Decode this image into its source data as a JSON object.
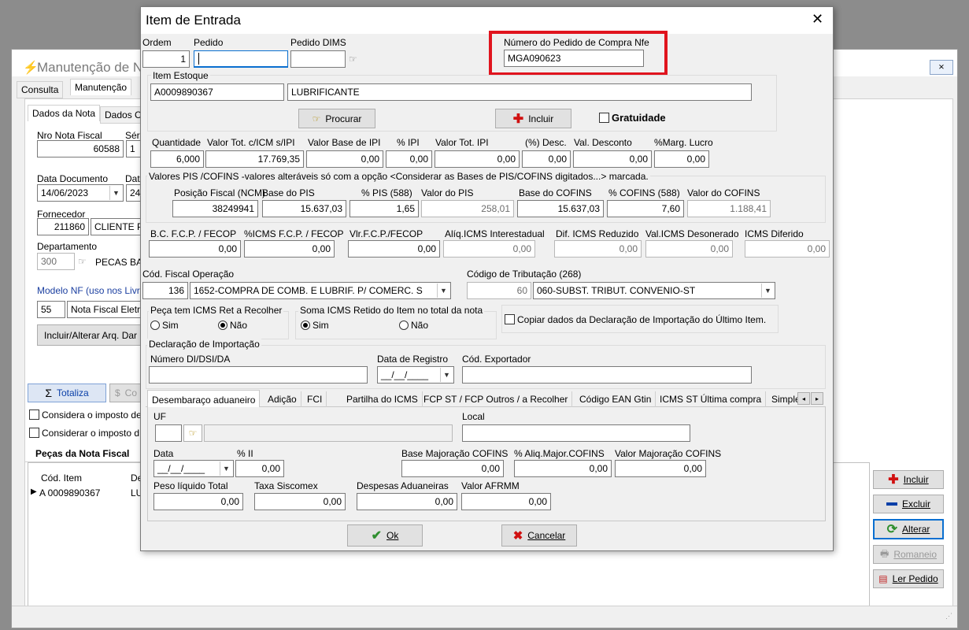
{
  "bg": {
    "title": "Manutenção de N",
    "tabs": [
      "Consulta",
      "Manutenção"
    ],
    "subtabs": [
      "Dados da Nota",
      "Dados C"
    ],
    "nro_nota_label": "Nro Nota Fiscal",
    "serie_label": "Séri",
    "nro_nota": "60588",
    "serie": "1",
    "data_doc_label": "Data Documento",
    "dat_label": "Dat",
    "data_doc": "14/06/2023",
    "dat2": "24,",
    "fornecedor_label": "Fornecedor",
    "fornecedor_cod": "211860",
    "fornecedor_nome": "CLIENTE P1",
    "departamento_label": "Departamento",
    "dep_cod": "300",
    "dep_nome": "PECAS BA",
    "modelo_label": "Modelo NF (uso nos Livro",
    "modelo_cod": "55",
    "modelo_nome": "Nota Fiscal Eletrô",
    "incluir_arq": "Incluir/Alterar Arq. Dar",
    "totaliza": "Totaliza",
    "co": "Co",
    "considera1": "Considera o imposto de",
    "considera2": "Considerar o imposto d",
    "pecas_title": "Peças da Nota Fiscal",
    "col_cod": "Cód. Item",
    "col_de": "De",
    "row_cod": "A  0009890367",
    "row_de": "LU",
    "incluir": "Incluir",
    "excluir": "Excluir",
    "alterar": "Alterar",
    "romaneio": "Romaneio",
    "ler_pedido": "Ler Pedido"
  },
  "dlg": {
    "title": "Item de Entrada",
    "ordem_label": "Ordem",
    "ordem": "1",
    "pedido_label": "Pedido",
    "pedido": "",
    "dims_label": "Pedido DIMS",
    "dims": "",
    "npc_label": "Número do Pedido de Compra Nfe",
    "npc": "MGA090623",
    "item_estoque_label": "Item Estoque",
    "item_cod": "A0009890367",
    "item_desc": "LUBRIFICANTE",
    "procurar": "Procurar",
    "incluir": "Incluir",
    "gratuidade": "Gratuidade",
    "quantidade_label": "Quantidade",
    "quantidade": "6,000",
    "vtot_label": "Valor Tot. c/ICM s/IPI",
    "vtot": "17.769,35",
    "vbase_ipi_label": "Valor Base de IPI",
    "vbase_ipi": "0,00",
    "pipi_label": "% IPI",
    "pipi": "0,00",
    "vtot_ipi_label": "Valor Tot. IPI",
    "vtot_ipi": "0,00",
    "pdesc_label": "(%) Desc.",
    "pdesc": "0,00",
    "vdesc_label": "Val. Desconto",
    "vdesc": "0,00",
    "marg_label": "%Marg. Lucro",
    "marg": "0,00",
    "pis_title": "Valores PIS /COFINS -valores alteráveis só com a opção <Considerar as Bases de PIS/COFINS digitados...> marcada.",
    "ncm_label": "Posição Fiscal (NCM)",
    "ncm": "38249941",
    "bpis_label": "Base do PIS",
    "bpis": "15.637,03",
    "ppis_label": "% PIS (588)",
    "ppis": "1,65",
    "vpis_label": "Valor do PIS",
    "vpis": "258,01",
    "bcof_label": "Base do COFINS",
    "bcof": "15.637,03",
    "pcof_label": "% COFINS (588)",
    "pcof": "7,60",
    "vcof_label": "Valor do COFINS",
    "vcof": "1.188,41",
    "bcfcp_label": "B.C. F.C.P. / FECOP",
    "bcfcp": "0,00",
    "picms_fcp_label": "%ICMS F.C.P. / FECOP",
    "picms_fcp": "0,00",
    "vlr_fcp_label": "Vlr.F.C.P./FECOP",
    "vlr_fcp": "0,00",
    "aliq_inter_label": "Alíq.ICMS Interestadual",
    "aliq_inter": "0,00",
    "dif_red_label": "Dif. ICMS Reduzido",
    "dif_red": "0,00",
    "desoner_label": "Val.ICMS Desonerado",
    "desoner": "0,00",
    "diferido_label": "ICMS Diferido",
    "diferido": "0,00",
    "cfop_label": "Cód. Fiscal Operação",
    "cfop_cod": "136",
    "cfop_desc": "1652-COMPRA DE COMB. E LUBRIF. P/ COMERC. S",
    "cst_label": "Código de Tributação (268)",
    "cst_cod": "60",
    "cst_desc": "060-SUBST. TRIBUT. CONVENIO-ST",
    "peca_icms_label": "Peça tem ICMS Ret a Recolher",
    "sim": "Sim",
    "nao": "Não",
    "soma_icms_label": "Soma ICMS Retido do Item no total da nota",
    "copiar": "Copiar dados da Declaração de Importação do Último Item.",
    "di_title": "Declaração de Importação",
    "ndi_label": "Número DI/DSI/DA",
    "ndi": "",
    "dreg_label": "Data de Registro",
    "dreg": "__/__/____",
    "cexp_label": "Cód. Exportador",
    "cexp": "",
    "tabs": [
      "Desembaraço aduaneiro",
      "Adição",
      "FCI",
      "Partilha do ICMS",
      "FCP ST / FCP Outros / a Recolher",
      "Código EAN Gtin",
      "ICMS ST Última compra",
      "Simple"
    ],
    "uf_label": "UF",
    "uf": "",
    "local_label": "Local",
    "local": "",
    "data_label": "Data",
    "data": "__/__/____",
    "pii_label": "% II",
    "pii": "0,00",
    "bmaj_label": "Base Majoração COFINS",
    "bmaj": "0,00",
    "amaj_label": "% Aliq.Major.COFINS",
    "amaj": "0,00",
    "vmaj_label": "Valor Majoração COFINS",
    "vmaj": "0,00",
    "peso_label": "Peso líquido Total",
    "peso": "0,00",
    "taxa_label": "Taxa Siscomex",
    "taxa": "0,00",
    "desp_label": "Despesas Aduaneiras",
    "desp": "0,00",
    "afrmm_label": "Valor AFRMM",
    "afrmm": "0,00",
    "ok": "Ok",
    "cancelar": "Cancelar"
  },
  "colors": {
    "highlight": "#e0141e",
    "accent_blue": "#0a3fa8",
    "red_plus": "#d01010",
    "green_check": "#2f8f2f"
  }
}
